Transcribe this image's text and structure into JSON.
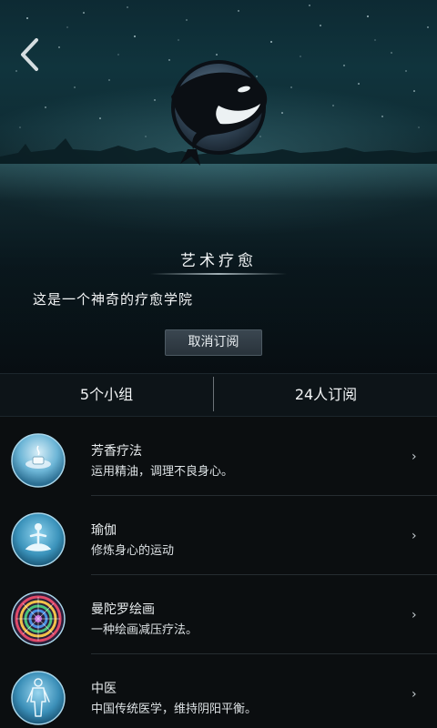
{
  "header": {
    "title": "艺术疗愈",
    "description": "这是一个神奇的疗愈学院",
    "unsubscribe_label": "取消订阅",
    "icons": {
      "back": "chevron-left-icon",
      "avatar": "whale-icon"
    }
  },
  "stats": {
    "groups": "5个小组",
    "subscribers": "24人订阅"
  },
  "items": [
    {
      "name": "芳香疗法",
      "sub": "运用精油，调理不良身心。",
      "chevron": "›",
      "icon": "aroma-icon"
    },
    {
      "name": "瑜伽",
      "sub": "修炼身心的运动",
      "chevron": "›",
      "icon": "meditation-icon"
    },
    {
      "name": "曼陀罗绘画",
      "sub": "一种绘画减压疗法。",
      "chevron": "›",
      "icon": "mandala-icon"
    },
    {
      "name": "中医",
      "sub": "中国传统医学，维持阴阳平衡。",
      "chevron": "›",
      "icon": "body-icon"
    }
  ],
  "colors": {
    "sky": "#10343d",
    "background": "#0b0e10",
    "thumb_blue": "#3f8fb5"
  }
}
